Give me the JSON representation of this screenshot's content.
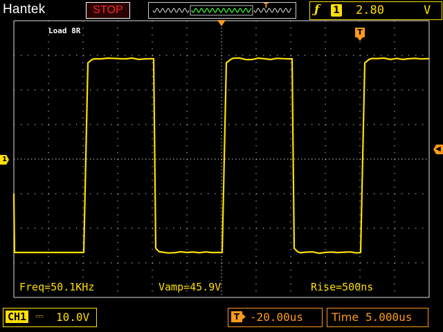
{
  "header": {
    "brand": "Hantek",
    "run_state": "STOP",
    "trigger_edge_icon": "rising-edge-icon",
    "trigger_source": "1",
    "trigger_level": "2.80",
    "trigger_level_unit": "V"
  },
  "markers": {
    "trigger_position_icon": "T",
    "channel1_ground": "1"
  },
  "screen": {
    "label": "Load 8R",
    "measurements": {
      "freq": "Freq=50.1KHz",
      "vamp": "Vamp=45.9V",
      "rise": "Rise=500ns"
    }
  },
  "waveform": {
    "channel": "CH1",
    "shape": "square",
    "trace_color": "#ffe000",
    "graticule_color": "#b0b0b0",
    "period_divisions": 4.0,
    "high_level_div": 2.9,
    "low_level_div": -2.7
  },
  "footer": {
    "channel": "CH1",
    "coupling_icon": "dc-coupling-icon",
    "volts_per_div": "10.0V",
    "trigger_delay": "-20.00us",
    "time_label": "Time",
    "time_per_div": "5.000us"
  },
  "colors": {
    "channel1": "#ffe000",
    "trigger": "#ff9a1a",
    "stop": "#ff2a2a",
    "background": "#000000"
  }
}
